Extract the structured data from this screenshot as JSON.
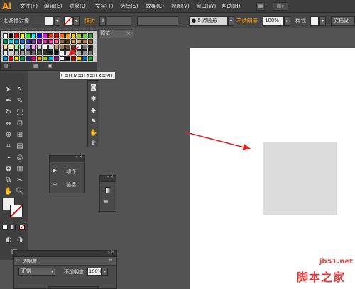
{
  "app": {
    "logo": "Ai"
  },
  "menubar": {
    "items": [
      "文件(F)",
      "编辑(E)",
      "对象(O)",
      "文字(T)",
      "选择(S)",
      "效果(C)",
      "视图(V)",
      "窗口(W)",
      "帮助(H)"
    ]
  },
  "control_bar": {
    "selection_status": "未选择对象",
    "stroke_label": "描边",
    "stroke_preset": "5 点圆形",
    "opacity_label": "不透明度",
    "opacity_value": "100%",
    "style_label": "样式",
    "doc_setup": "文档设"
  },
  "document": {
    "tab_label": "预览)"
  },
  "swatches": {
    "tooltip": "C=0 M=0 Y=0 K=20",
    "rows": [
      [
        "#ffffff",
        "#000000",
        "#ff0000",
        "#ffff00",
        "#00ff00",
        "#00ffff",
        "#0000ff",
        "#ff00ff",
        "#ff3300",
        "#cc0000",
        "#ff6600",
        "#ff9900",
        "#ffcc00",
        "#99cc00",
        "#66cc33",
        "#339933"
      ],
      [
        "#009966",
        "#00cccc",
        "#0099cc",
        "#3366cc",
        "#333399",
        "#663399",
        "#990099",
        "#cc3399",
        "#ff3399",
        "#ff6699",
        "#996633",
        "#663300",
        "#cc9966",
        "#ccaa88",
        "#aa7744",
        "#885522"
      ],
      [
        "#ffcc99",
        "#ffff99",
        "#99ff99",
        "#99ffff",
        "#9999ff",
        "#ff99ff",
        "#cccccc",
        "#ffffff",
        "#dddddd",
        "#c2a070",
        "#a07850",
        "#705030",
        "#503820",
        "#ffffff",
        "#777777",
        "#222222"
      ],
      [
        "#e6e6e6",
        "#cccccc",
        "#b3b3b3",
        "#999999",
        "#808080",
        "#666666",
        "#4d4d4d",
        "#333333",
        "#1a1a1a",
        "#000000",
        "#f2f2f2",
        "#d9d9d9",
        "#bfbfbf",
        "#a6a6a6",
        "#8c8c8c",
        "#737373"
      ],
      [
        "#00a0e9",
        "#e60012",
        "#fff100",
        "#009944",
        "#1d2088",
        "#e4007f",
        "#f39800",
        "#8fc31f",
        "#00b7ee",
        "#920783",
        "#ffffff",
        "#000000",
        "#a40000",
        "#ffcc00",
        "#0068b7",
        "#22ac38"
      ]
    ]
  },
  "actions_panel": {
    "actions_label": "动作",
    "links_label": "链接"
  },
  "transparency_panel": {
    "title": "透明度",
    "blend_mode": "正常",
    "opacity_label": "不透明度",
    "opacity_value": "100%"
  },
  "watermark": {
    "site": "jb51.net",
    "name": "脚本之家"
  },
  "colors": {
    "arrow": "#e02020",
    "accent": "#ff9a00",
    "artboard": "#ffffff",
    "rect_fill": "#dcdcdc"
  }
}
